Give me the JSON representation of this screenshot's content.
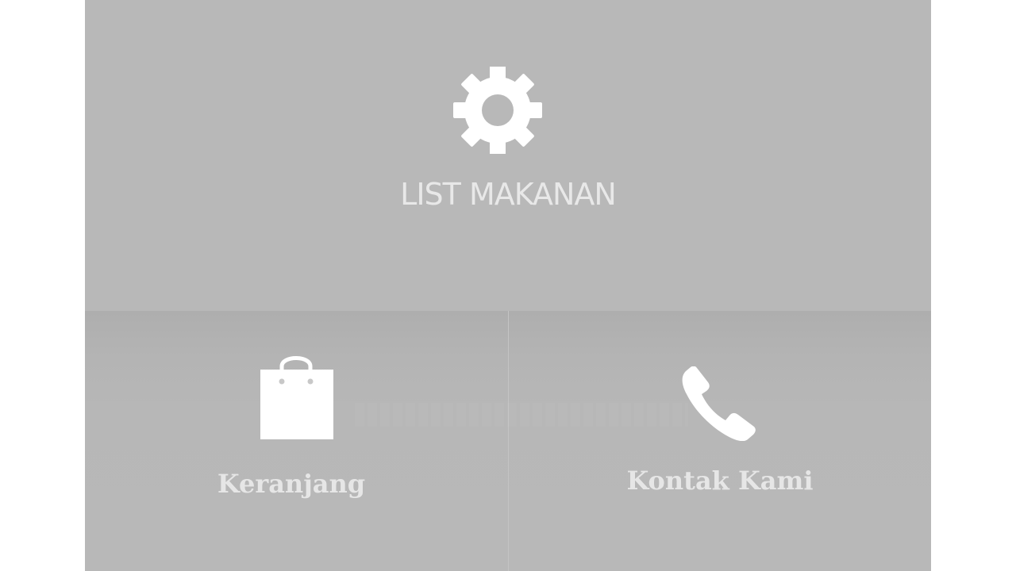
{
  "menu": {
    "top_tile": {
      "label": "LIST MAKANAN",
      "icon": "gear-icon"
    },
    "bottom_left_tile": {
      "label": "Keranjang",
      "icon": "shopping-bag-icon"
    },
    "bottom_right_tile": {
      "label": "Kontak Kami",
      "icon": "phone-icon"
    }
  },
  "colors": {
    "background": "#b8b8b8",
    "icon": "#ffffff",
    "label": "#e8e8e8"
  }
}
